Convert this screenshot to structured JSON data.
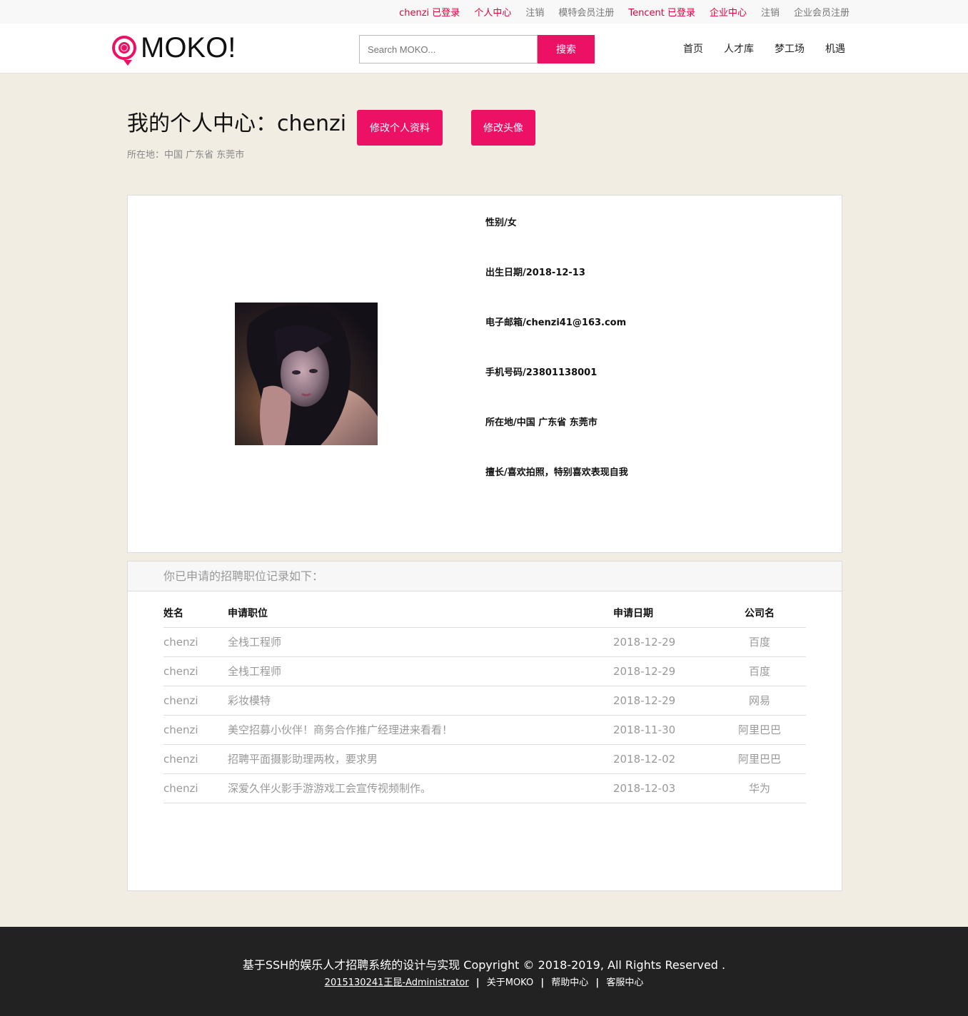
{
  "topbar": {
    "user_status": "chenzi 已登录",
    "personal_center": "个人中心",
    "logout1": "注销",
    "model_register": "模特会员注册",
    "company_status": "Tencent 已登录",
    "company_center": "企业中心",
    "logout2": "注销",
    "company_register": "企业会员注册"
  },
  "header": {
    "logo_text": "MOKO!",
    "search_placeholder": "Search MOKO...",
    "search_button": "搜索",
    "nav": [
      "首页",
      "人才库",
      "梦工场",
      "机遇"
    ]
  },
  "profile": {
    "title": "我的个人中心：chenzi",
    "location_line": "所在地：中国 广东省 东莞市",
    "edit_profile_button": "修改个人资料",
    "edit_avatar_button": "修改头像",
    "fields": [
      "性别/女",
      "出生日期/2018-12-13",
      "电子邮箱/chenzi41@163.com",
      "手机号码/23801138001",
      "所在地/中国 广东省 东莞市",
      "擅长/喜欢拍照，特别喜欢表现自我"
    ]
  },
  "applications": {
    "heading": "你已申请的招聘职位记录如下：",
    "columns": [
      "姓名",
      "申请职位",
      "申请日期",
      "公司名"
    ],
    "rows": [
      [
        "chenzi",
        "全栈工程师",
        "2018-12-29",
        "百度"
      ],
      [
        "chenzi",
        "全栈工程师",
        "2018-12-29",
        "百度"
      ],
      [
        "chenzi",
        "彩妆模特",
        "2018-12-29",
        "网易"
      ],
      [
        "chenzi",
        "美空招募小伙伴！商务合作推广经理进来看看！",
        "2018-11-30",
        "阿里巴巴"
      ],
      [
        "chenzi",
        "招聘平面摄影助理两枚，要求男",
        "2018-12-02",
        "阿里巴巴"
      ],
      [
        "chenzi",
        "深爱久伴火影手游游戏工会宣传视频制作。",
        "2018-12-03",
        "华为"
      ]
    ]
  },
  "footer": {
    "copyright": "基于SSH的娱乐人才招聘系统的设计与实现 Copyright © 2018-2019, All Rights Reserved .",
    "author_link": "2015130241王昆-Administrator",
    "links": [
      "关于MOKO",
      "帮助中心",
      "客服中心"
    ],
    "separator": "|"
  },
  "colors": {
    "accent": "#ed1165",
    "topbar_red": "#e3003b",
    "background": "#f1ede3",
    "footer_bg": "#222222"
  }
}
